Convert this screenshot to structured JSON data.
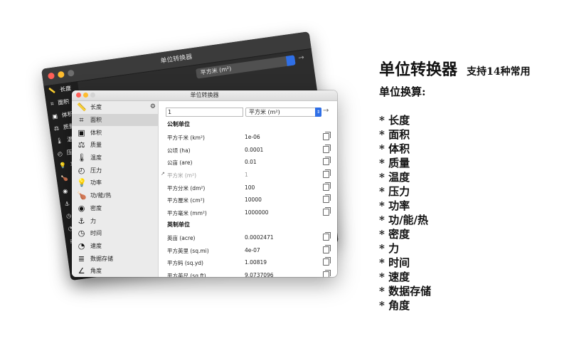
{
  "back_window": {
    "title": "单位转换器",
    "selected_unit": "平方米 (m²)",
    "sidebar_items": [
      "长度",
      "面积",
      "体积",
      "质量",
      "温度",
      "压力",
      "功率",
      "功/能/热",
      "密度",
      "力",
      "时间",
      "速度",
      "数据存储",
      "角度"
    ]
  },
  "window": {
    "title": "单位转换器",
    "input_value": "1",
    "selected_unit": "平方米 (m²)",
    "sidebar": [
      {
        "label": "长度",
        "icon": "ruler-icon",
        "glyph": "📏"
      },
      {
        "label": "面积",
        "icon": "area-crop-icon",
        "glyph": "⌗"
      },
      {
        "label": "体积",
        "icon": "cube-icon",
        "glyph": "▣"
      },
      {
        "label": "质量",
        "icon": "weight-icon",
        "glyph": "⚖"
      },
      {
        "label": "温度",
        "icon": "thermometer-icon",
        "glyph": "🌡"
      },
      {
        "label": "压力",
        "icon": "gauge-icon",
        "glyph": "◴"
      },
      {
        "label": "功率",
        "icon": "bulb-icon",
        "glyph": "💡"
      },
      {
        "label": "功/能/热",
        "icon": "drumstick-icon",
        "glyph": "🍗"
      },
      {
        "label": "密度",
        "icon": "density-icon",
        "glyph": "◉"
      },
      {
        "label": "力",
        "icon": "force-icon",
        "glyph": "⚓"
      },
      {
        "label": "时间",
        "icon": "clock-icon",
        "glyph": "◷"
      },
      {
        "label": "速度",
        "icon": "speedometer-icon",
        "glyph": "◔"
      },
      {
        "label": "数据存储",
        "icon": "database-icon",
        "glyph": "≣"
      },
      {
        "label": "角度",
        "icon": "angle-icon",
        "glyph": "∠"
      }
    ],
    "active_index": 1,
    "sections": [
      {
        "title": "公制单位",
        "rows": [
          {
            "name": "平方千米 (km²)",
            "value": "1e-06"
          },
          {
            "name": "公顷 (ha)",
            "value": "0.0001"
          },
          {
            "name": "公亩 (are)",
            "value": "0.01"
          },
          {
            "name": "平方米 (m²)",
            "value": "1",
            "current": true
          },
          {
            "name": "平方分米 (dm²)",
            "value": "100"
          },
          {
            "name": "平方厘米 (cm²)",
            "value": "10000"
          },
          {
            "name": "平方毫米 (mm²)",
            "value": "1000000"
          }
        ]
      },
      {
        "title": "英制单位",
        "rows": [
          {
            "name": "英亩 (acre)",
            "value": "0.0002471"
          },
          {
            "name": "平方英里 (sq.mi)",
            "value": "4e-07"
          },
          {
            "name": "平方码 (sq.yd)",
            "value": "1.00819"
          },
          {
            "name": "平方英尺 (sq.ft)",
            "value": "9.0737096"
          }
        ]
      }
    ]
  },
  "description": {
    "title": "单位转换器",
    "subtitle": "支持14种常用",
    "line2": "单位换算:",
    "features": [
      "* 长度",
      "* 面积",
      "* 体积",
      "* 质量",
      "* 温度",
      "* 压力",
      "* 功率",
      "* 功/能/热",
      "* 密度",
      "* 力",
      "* 时间",
      "* 速度",
      "* 数据存储",
      "* 角度"
    ]
  }
}
